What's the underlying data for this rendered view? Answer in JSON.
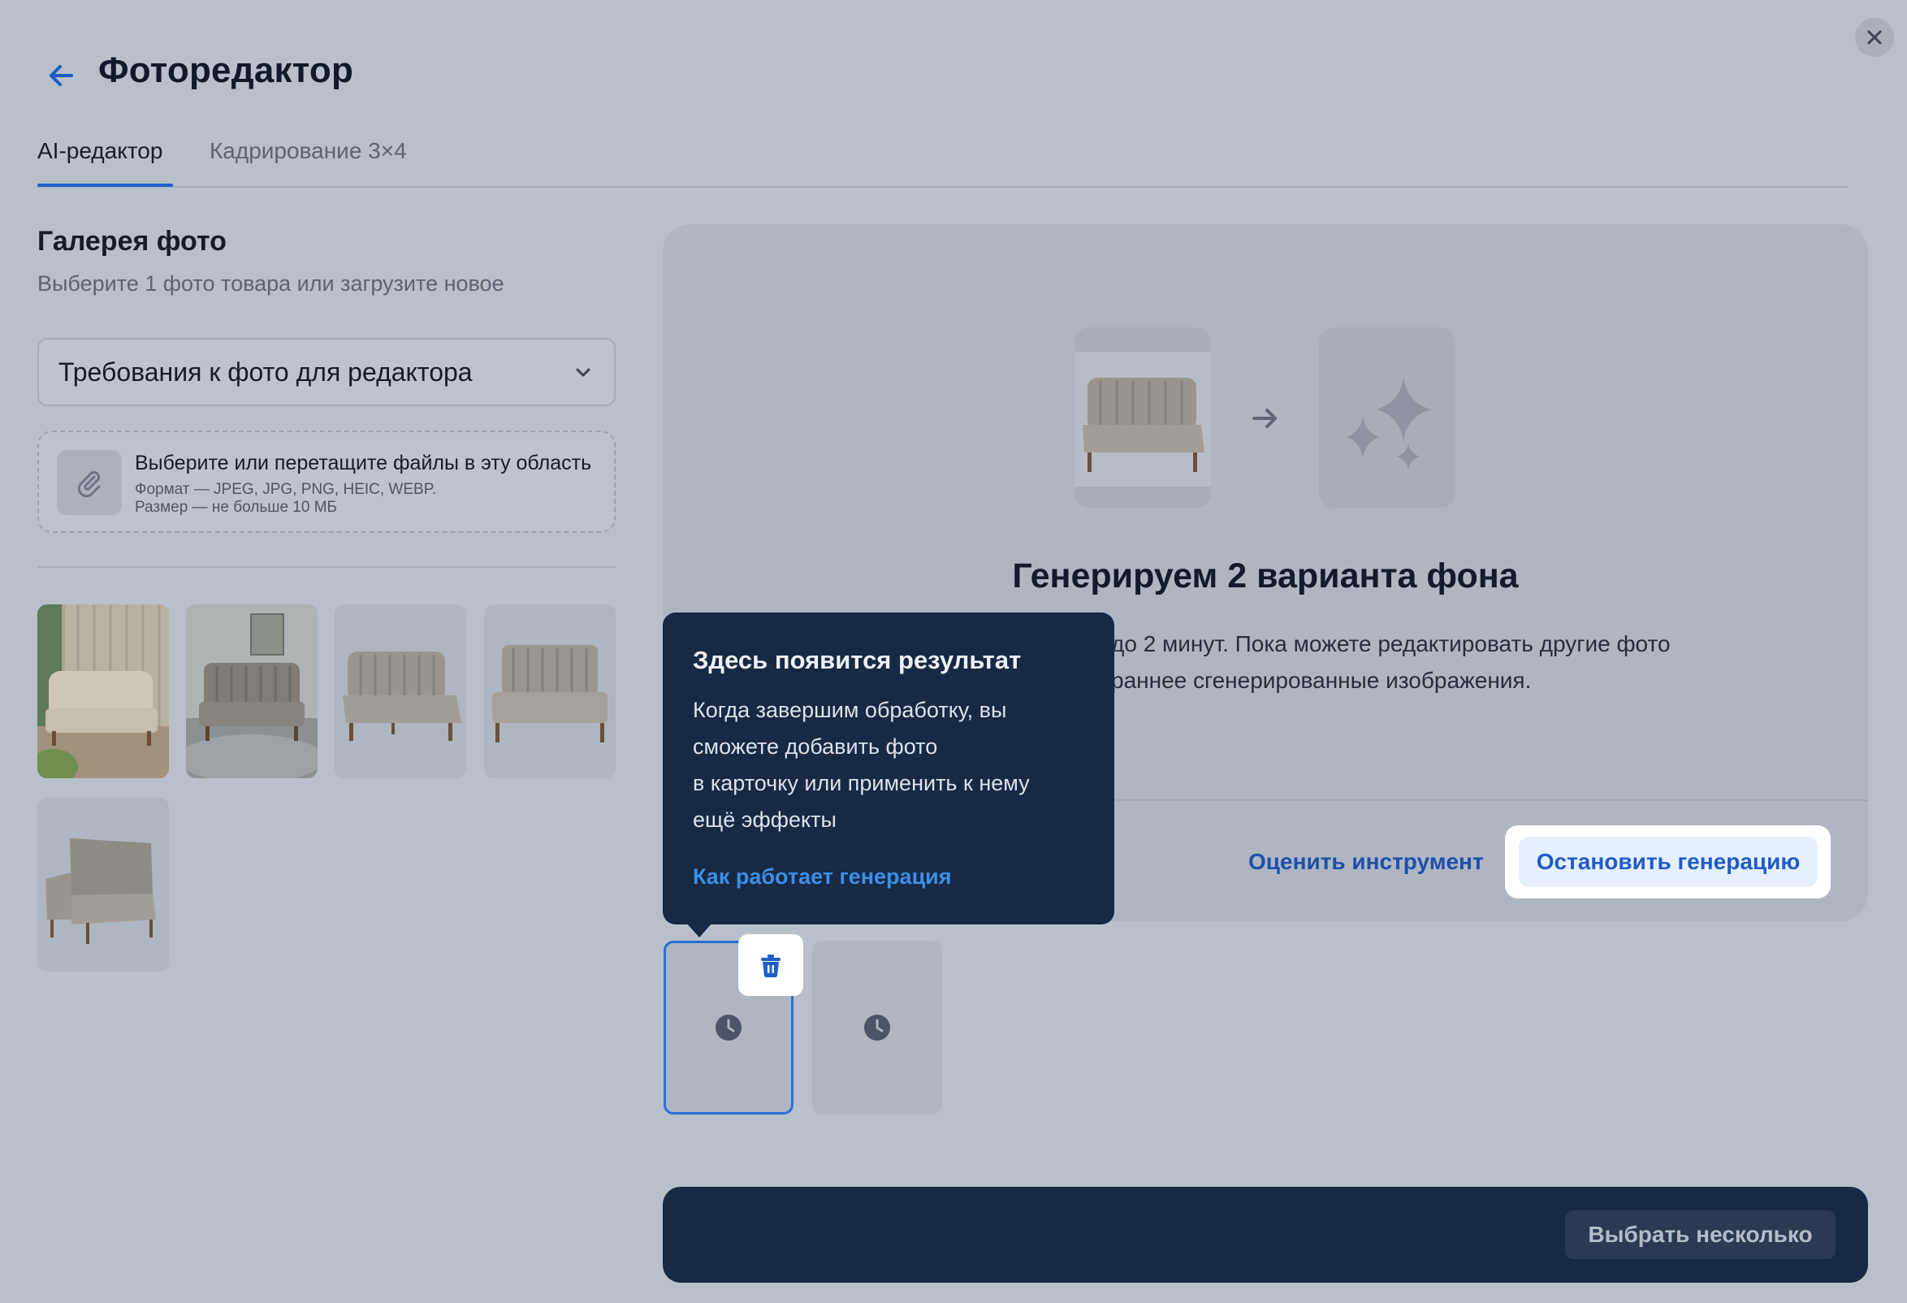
{
  "header": {
    "title": "Фоторедактор"
  },
  "tabs": [
    {
      "label": "AI-редактор",
      "active": true
    },
    {
      "label": "Кадрирование 3×4",
      "active": false
    }
  ],
  "gallery": {
    "title": "Галерея фото",
    "subtitle": "Выберите 1 фото товара или загрузите новое",
    "requirements_dropdown": "Требования к фото для редактора",
    "upload": {
      "title": "Выберите или перетащите файлы в эту область",
      "format": "Формат — JPEG, JPG, PNG, HEIC, WEBP.",
      "size": "Размер — не больше 10 МБ"
    },
    "thumbnail_count": 5
  },
  "result_panel": {
    "title": "Генерируем 2 варианта фона",
    "subtitle_lines": [
      "до 2 минут. Пока можете редактировать другие фото",
      "раннее сгенерированные изображения."
    ],
    "rate_link": "Оценить инструмент",
    "stop_button": "Остановить генерацию"
  },
  "tooltip": {
    "title": "Здесь появится результат",
    "body_lines": [
      "Когда завершим обработку, вы",
      "сможете добавить фото",
      "в карточку или применить к нему",
      "ещё эффекты"
    ],
    "link": "Как работает генерация"
  },
  "bottom_bar": {
    "select_multiple": "Выбрать несколько"
  },
  "colors": {
    "accent": "#1f5cc8",
    "overlay_bg": "#b8c0cb",
    "tooltip_bg": "#172943"
  },
  "icons": [
    "back-arrow-icon",
    "close-icon",
    "chevron-down-icon",
    "paperclip-icon",
    "arrow-right-icon",
    "sparkles-icon",
    "trash-icon",
    "clock-icon"
  ]
}
